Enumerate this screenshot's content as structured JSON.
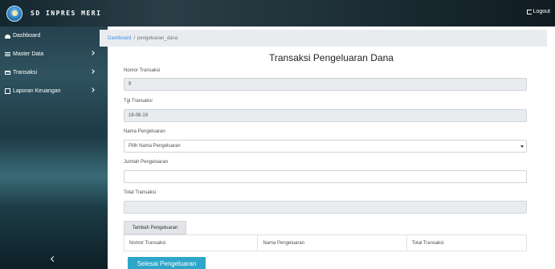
{
  "brand": {
    "name": "SD INPRES MERI",
    "logo_icon": "school-logo-icon"
  },
  "header": {
    "logout_label": "Logout",
    "logout_icon": "logout-icon"
  },
  "sidebar": {
    "items": [
      {
        "label": "Dashboard",
        "icon": "dashboard-icon",
        "has_submenu": false
      },
      {
        "label": "Master Data",
        "icon": "menu-icon",
        "has_submenu": true
      },
      {
        "label": "Transaksi",
        "icon": "cart-icon",
        "has_submenu": true
      },
      {
        "label": "Laporan Keuangan",
        "icon": "document-icon",
        "has_submenu": true
      }
    ],
    "toggle_icon": "chevron-left-icon"
  },
  "breadcrumb": {
    "root": "Dashboard",
    "separator": "/",
    "current": "pengeluaran_dana"
  },
  "page": {
    "title": "Transaksi Pengeluaran Dana"
  },
  "form": {
    "nomor_transaksi": {
      "label": "Nomor Transaksi",
      "value": "9"
    },
    "tgl_transaksi": {
      "label": "Tgl Transaksi",
      "value": "18-06-19"
    },
    "nama_pengeluaran": {
      "label": "Nama Pengeluaran",
      "selected": "Pilih Nama Pengeluaran"
    },
    "jumlah_pengeluaran": {
      "label": "Jumlah Pengeluaran",
      "value": ""
    },
    "total_transaksi": {
      "label": "Total Transaksi",
      "value": ""
    }
  },
  "buttons": {
    "tambah": "Tambah Pengeluaran",
    "selesai": "Selesai Pengeluaran"
  },
  "table": {
    "headers": [
      "Nomor Transaksi",
      "Nama Pengeluaran",
      "Total Transaksi"
    ]
  },
  "colors": {
    "primary_button": "#2ea6c9",
    "link": "#3a8ee6",
    "readonly_bg": "#e9ecef"
  }
}
